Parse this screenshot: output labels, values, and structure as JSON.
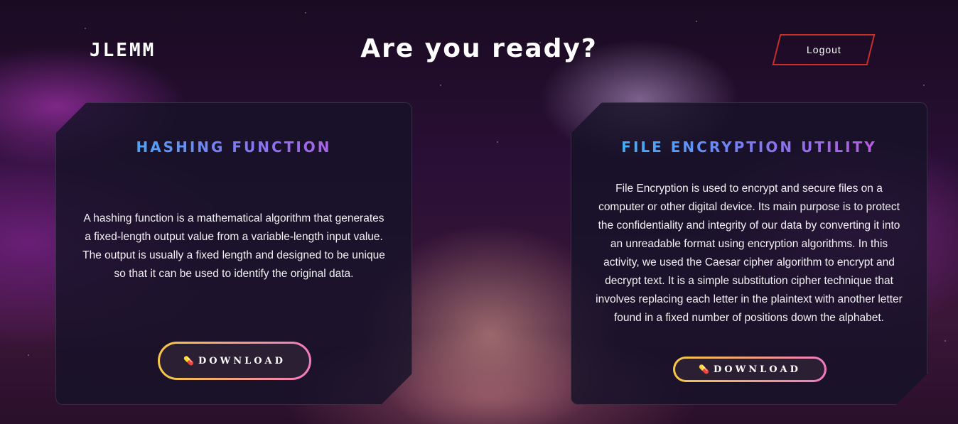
{
  "header": {
    "brand": "JLEMM",
    "headline": "Are you ready?",
    "logout_label": "Logout"
  },
  "cards": [
    {
      "title": "HASHING FUNCTION",
      "text": "A hashing function is a mathematical algorithm that generates a fixed-length output value from a variable-length input value. The output is usually a fixed length and designed to be unique so that it can be used to identify the original data.",
      "button_label": "DOWNLOAD",
      "button_icon": "pill-icon"
    },
    {
      "title": "FILE ENCRYPTION UTILITY",
      "text": "File Encryption is used to encrypt and secure files on a computer or other digital device. Its main purpose is to protect the confidentiality and integrity of our data by converting it into an unreadable format using encryption algorithms. In this activity, we used the Caesar cipher algorithm to encrypt and decrypt text. It is a simple substitution cipher technique that involves replacing each letter in the plaintext with another letter found in a fixed number of positions down the alphabet.",
      "button_label": "DOWNLOAD",
      "button_icon": "pill-icon"
    }
  ],
  "colors": {
    "logout_border": "#c9302c",
    "title_gradient_start": "#26c6f9",
    "title_gradient_end": "#d24dd6",
    "button_gradient_start": "#f5c842",
    "button_gradient_end": "#f07ac0"
  }
}
